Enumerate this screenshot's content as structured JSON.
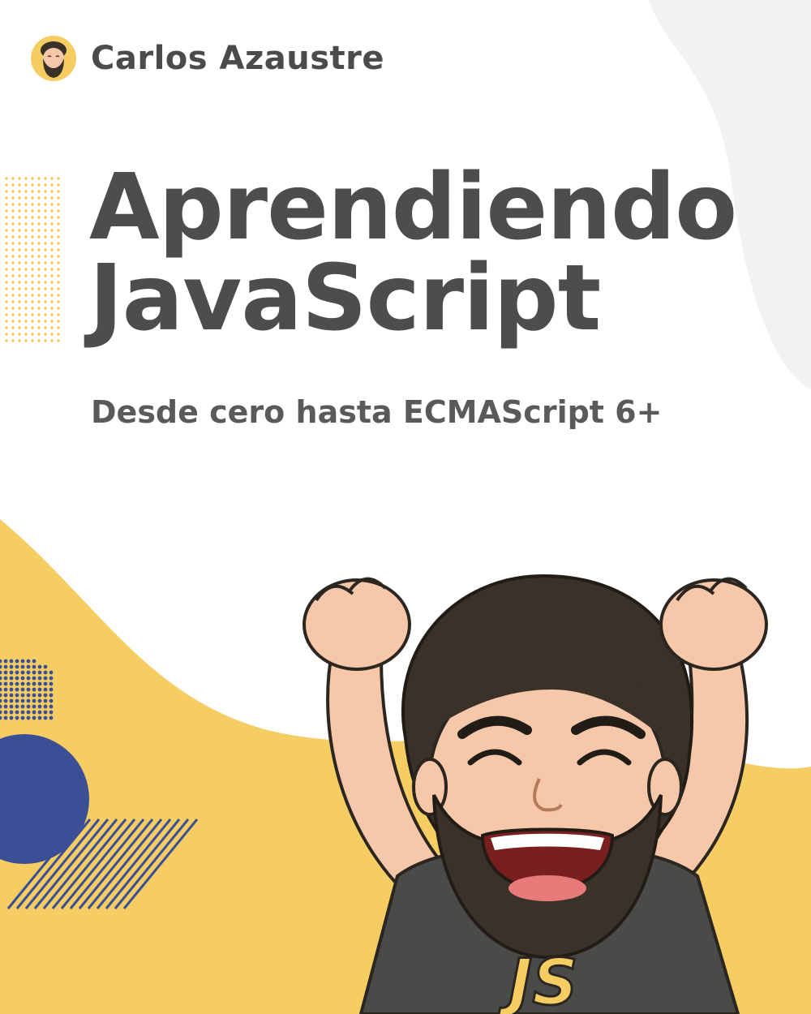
{
  "author": {
    "name": "Carlos Azaustre",
    "avatar_icon": "author-avatar-icon"
  },
  "title": {
    "line1": "Aprendiendo",
    "line2": "JavaScript"
  },
  "subtitle": "Desde cero hasta ECMAScript 6+",
  "illustration": {
    "name": "cheering-bearded-man",
    "shirt_text": "JS"
  },
  "colors": {
    "background": "#ffffff",
    "grey_blob": "#f2f2f2",
    "yellow": "#f6cd63",
    "navy": "#3b4f96",
    "title_text": "#4d4d4d",
    "hair": "#3a3229",
    "skin": "#f6c7a8",
    "shirt": "#4a4a48"
  }
}
